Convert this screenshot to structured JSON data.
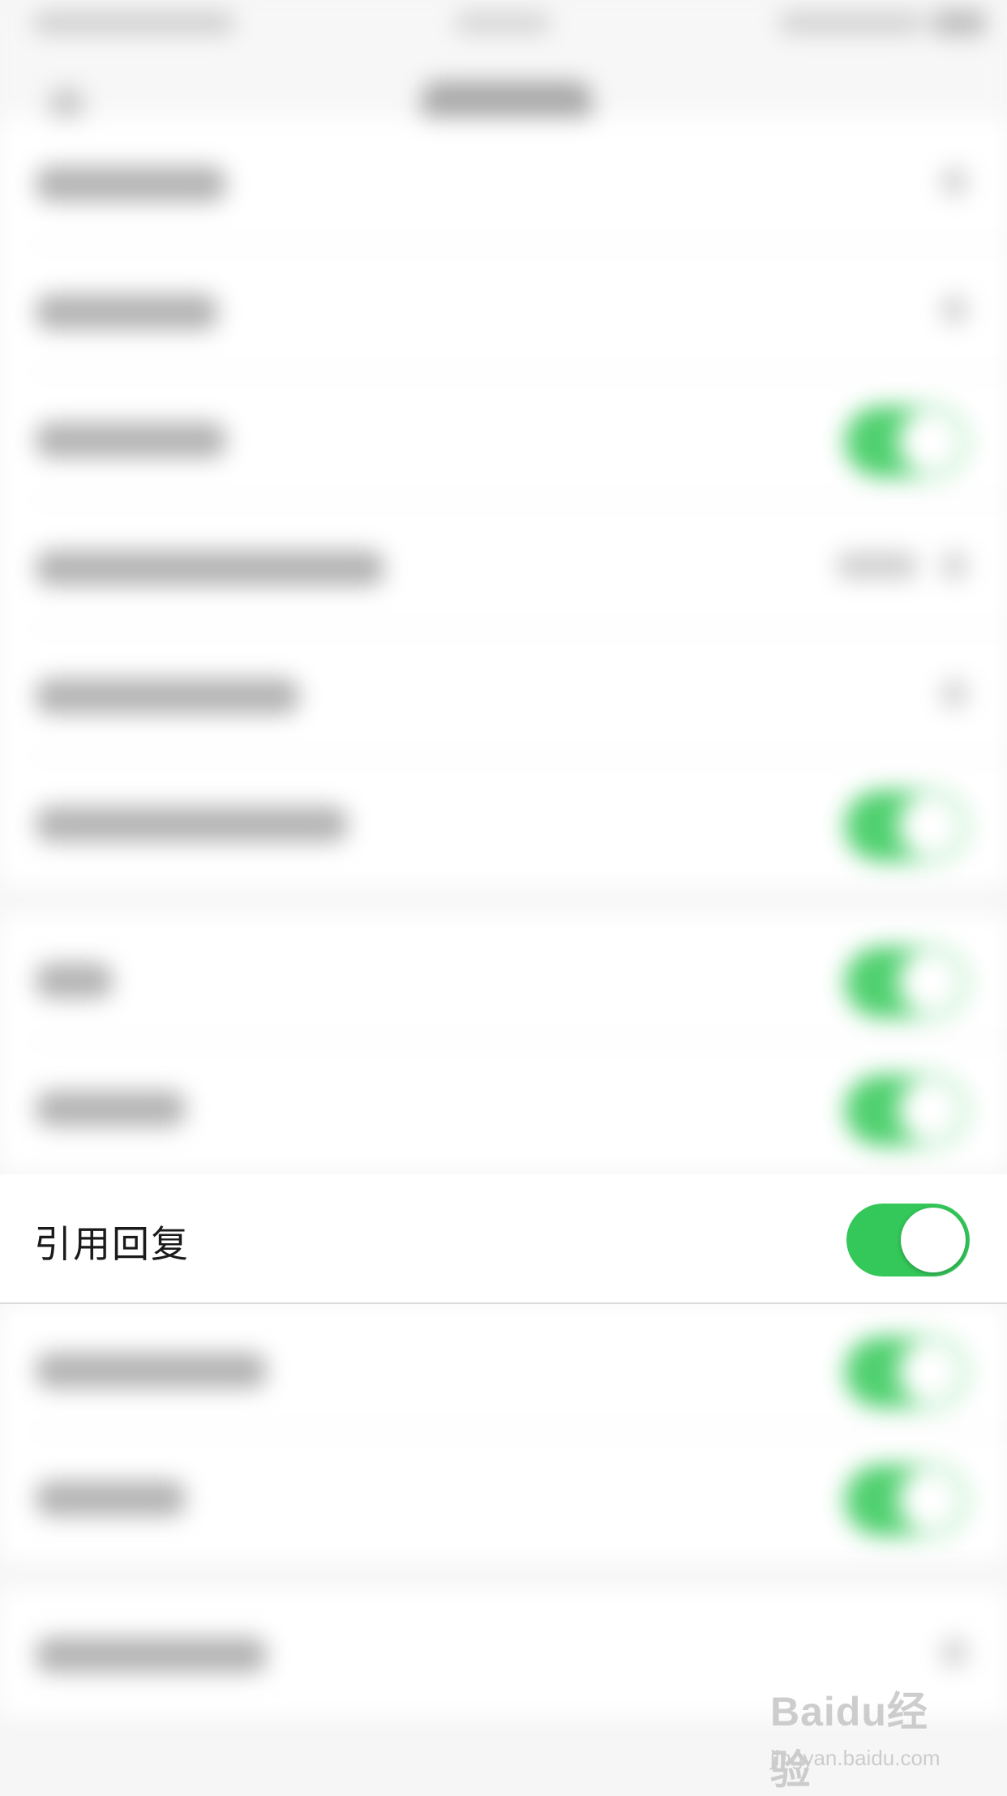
{
  "colors": {
    "toggle_on": "#34c759",
    "background": "#f6f6f6"
  },
  "background_rows": [
    {
      "control": "chevron"
    },
    {
      "control": "chevron"
    },
    {
      "control": "toggle"
    },
    {
      "control": "value"
    },
    {
      "control": "chevron"
    },
    {
      "control": "toggle"
    },
    {
      "control": "toggle"
    },
    {
      "control": "toggle"
    },
    {
      "control": "toggle"
    },
    {
      "control": "toggle"
    },
    {
      "control": "chevron"
    }
  ],
  "setting": {
    "label": "引用回复",
    "toggle_on": true
  },
  "watermark": {
    "logo": "Baidu经验",
    "url": "jingyan.baidu.com"
  }
}
